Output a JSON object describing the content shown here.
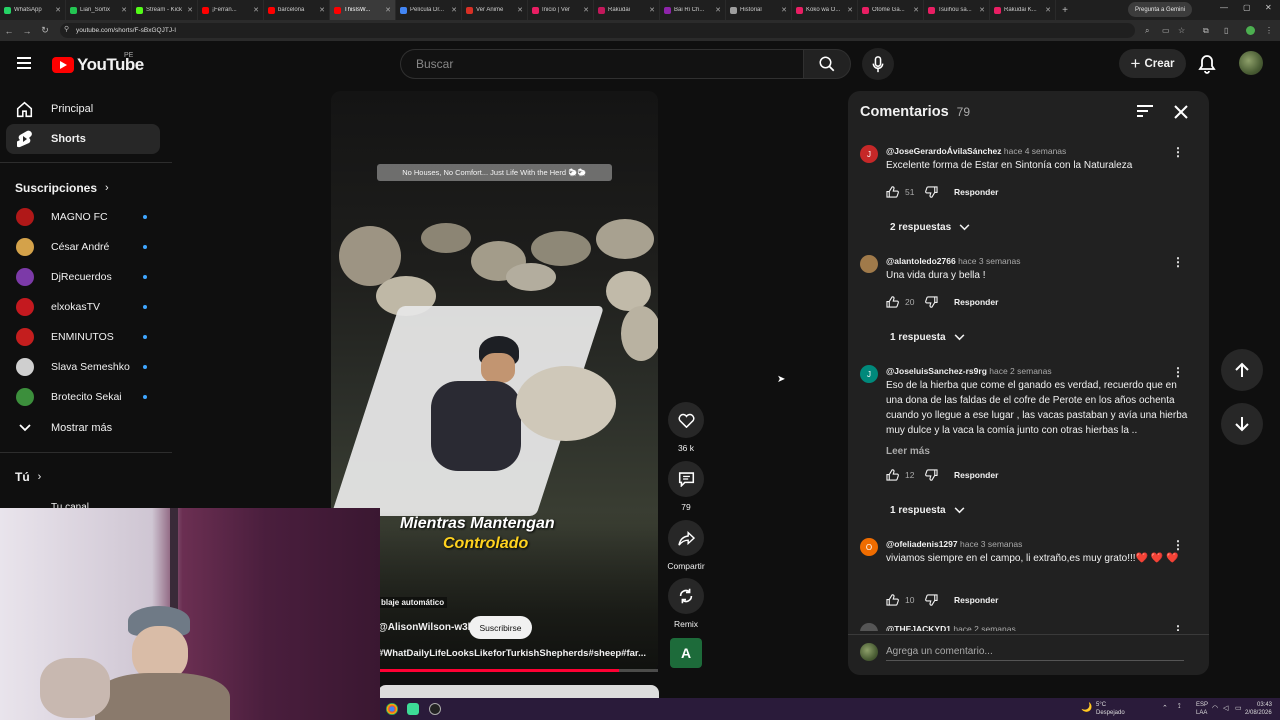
{
  "browser": {
    "tabs": [
      {
        "label": "WhatsApp",
        "color": "#25d366"
      },
      {
        "label": "Lian_Sortix",
        "color": "#23c552"
      },
      {
        "label": "Stream - Kick",
        "color": "#53fc18"
      },
      {
        "label": "¡Ferran...",
        "color": "#ff0000"
      },
      {
        "label": "barcelona",
        "color": "#ff0000"
      },
      {
        "label": "ThisIsW...",
        "color": "#ff0000",
        "active": true
      },
      {
        "label": "Película Dr...",
        "color": "#4285f4"
      },
      {
        "label": "Ver Anime",
        "color": "#d93025"
      },
      {
        "label": "Inicio | Ver",
        "color": "#e91e63"
      },
      {
        "label": "Rakudai",
        "color": "#c2185b"
      },
      {
        "label": "Bai Ri Ch...",
        "color": "#8e24aa"
      },
      {
        "label": "Historial",
        "color": "#9e9e9e"
      },
      {
        "label": "Koko wa O...",
        "color": "#e91e63"
      },
      {
        "label": "Otome Ga...",
        "color": "#e91e63"
      },
      {
        "label": "Tsuihou sa...",
        "color": "#e91e63"
      },
      {
        "label": "Rakudai K...",
        "color": "#e91e63"
      }
    ],
    "new_tab": "+",
    "gemini_label": "Pregunta a Gemini",
    "url": "youtube.com/shorts/F-sBxGQJTJ-I"
  },
  "header": {
    "logo_text": "YouTube",
    "region": "PE",
    "search_placeholder": "Buscar",
    "create_label": "Crear"
  },
  "sidebar": {
    "main_items": [
      {
        "label": "Principal",
        "icon": "home-icon"
      },
      {
        "label": "Shorts",
        "icon": "shorts-icon",
        "active": true
      }
    ],
    "subscriptions_title": "Suscripciones",
    "subscriptions": [
      {
        "label": "MAGNO FC",
        "color": "#b01818"
      },
      {
        "label": "César André",
        "color": "#d4a24a"
      },
      {
        "label": "DjRecuerdos",
        "color": "#7c3aa8"
      },
      {
        "label": "elxokasTV",
        "color": "#c4191f"
      },
      {
        "label": "ENMINUTOS",
        "color": "#c41e1e"
      },
      {
        "label": "Slava Semeshko",
        "color": "#cfcfcf"
      },
      {
        "label": "Brotecito Sekai",
        "color": "#3c8f3c"
      }
    ],
    "show_more": "Mostrar más",
    "you_title": "Tú",
    "your_channel": "Tu canal"
  },
  "video": {
    "banner": "No Houses, No Comfort... Just Life With the Herd 🐑🐑",
    "caption_line1": "Mientras Mantengan",
    "caption_line2": "Controlado",
    "auto_dub": "blaje automático",
    "channel_handle": "@AlisonWilson-w3l",
    "subscribe": "Suscribirse",
    "hashtags": "#WhatDailyLifeLooksLikeforTurkishShepherds#sheep#far...",
    "progress": 0.88
  },
  "actions": {
    "likes": "36 k",
    "comments": "79",
    "share": "Compartir",
    "remix": "Remix",
    "channel_letter": "A"
  },
  "comments": {
    "title": "Comentarios",
    "count": "79",
    "reply_label": "Responder",
    "read_more": "Leer más",
    "input_placeholder": "Agrega un comentario...",
    "items": [
      {
        "author": "@JoseGerardoÁvilaSánchez",
        "time": "hace 4 semanas",
        "text": "Excelente forma de Estar en Sintonía con la Naturaleza",
        "likes": "51",
        "replies": "2 respuestas",
        "avatar_letter": "J",
        "avatar_color": "#c62828"
      },
      {
        "author": "@alantoledo2766",
        "time": "hace 3 semanas",
        "text": "Una vida dura y bella !",
        "likes": "20",
        "replies": "1 respuesta",
        "avatar_letter": "",
        "avatar_color": "#a07a4a"
      },
      {
        "author": "@JoseluisSanchez-rs9rg",
        "time": "hace 2 semanas",
        "text": "Eso de la hierba que come el ganado es verdad, recuerdo que en una dona de las faldas de el cofre de Perote en los años ochenta cuando yo llegue a ese lugar , las vacas pastaban y avía una hierba muy dulce y la vaca la comía junto con otras hierbas la ..",
        "likes": "12",
        "replies": "1 respuesta",
        "avatar_letter": "J",
        "avatar_color": "#00897b"
      },
      {
        "author": "@ofeliadenis1297",
        "time": "hace 3 semanas",
        "text": "viviamos siempre en el campo, li extraño,es muy grato!!!❤️ ❤️ ❤️",
        "likes": "10",
        "replies": "",
        "avatar_letter": "O",
        "avatar_color": "#ef6c00"
      },
      {
        "author": "@THEJACKYD1",
        "time": "hace 2 semanas",
        "text": "",
        "likes": "",
        "replies": "",
        "avatar_letter": "",
        "avatar_color": "#555555"
      }
    ]
  },
  "taskbar": {
    "weather_temp": "5°C",
    "weather_desc": "Despejado",
    "lang": "ESP",
    "lang2": "LAA",
    "time": "03:43",
    "date": "2/08/2026"
  }
}
